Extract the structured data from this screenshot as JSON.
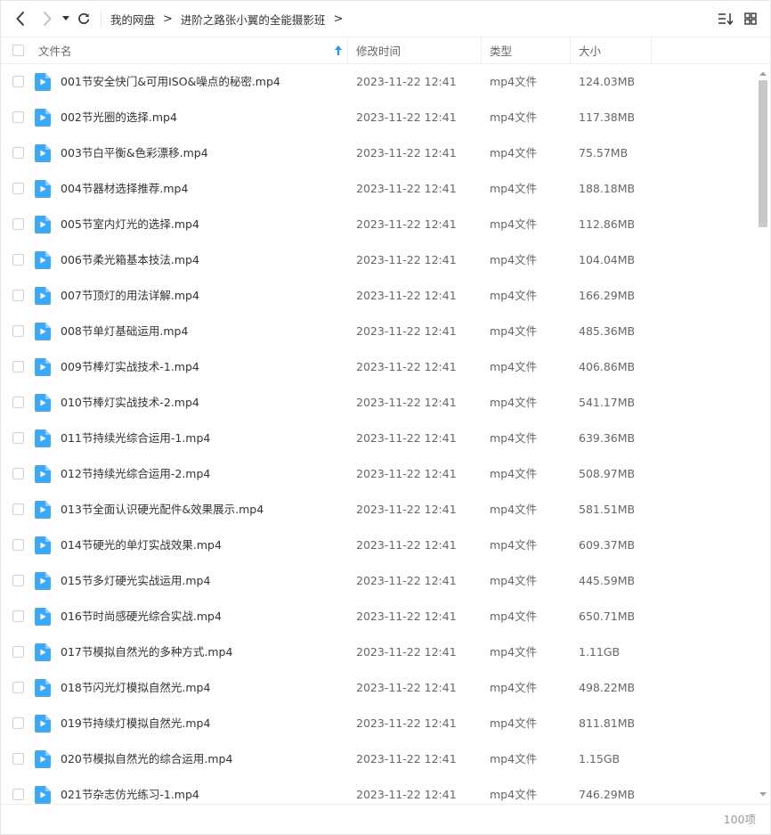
{
  "toolbar": {
    "back_icon": "chevron-left-icon",
    "forward_icon": "chevron-right-icon",
    "history_icon": "caret-down-icon",
    "refresh_icon": "refresh-icon",
    "sort_icon": "sort-list-icon",
    "view_icon": "grid-view-icon"
  },
  "breadcrumb": {
    "items": [
      "我的网盘",
      "进阶之路张小翼的全能摄影班"
    ],
    "separator": ">"
  },
  "columns": {
    "name": "文件名",
    "modified": "修改时间",
    "type": "类型",
    "size": "大小"
  },
  "colors": {
    "file_icon": "#3fa9f5",
    "sort_arrow": "#2196f3",
    "text": "#333333",
    "muted": "#666666"
  },
  "files": [
    {
      "name": "001节安全快门&可用ISO&噪点的秘密.mp4",
      "modified": "2023-11-22 12:41",
      "type": "mp4文件",
      "size": "124.03MB"
    },
    {
      "name": "002节光圈的选择.mp4",
      "modified": "2023-11-22 12:41",
      "type": "mp4文件",
      "size": "117.38MB"
    },
    {
      "name": "003节白平衡&色彩漂移.mp4",
      "modified": "2023-11-22 12:41",
      "type": "mp4文件",
      "size": "75.57MB"
    },
    {
      "name": "004节器材选择推荐.mp4",
      "modified": "2023-11-22 12:41",
      "type": "mp4文件",
      "size": "188.18MB"
    },
    {
      "name": "005节室内灯光的选择.mp4",
      "modified": "2023-11-22 12:41",
      "type": "mp4文件",
      "size": "112.86MB"
    },
    {
      "name": "006节柔光箱基本技法.mp4",
      "modified": "2023-11-22 12:41",
      "type": "mp4文件",
      "size": "104.04MB"
    },
    {
      "name": "007节顶灯的用法详解.mp4",
      "modified": "2023-11-22 12:41",
      "type": "mp4文件",
      "size": "166.29MB"
    },
    {
      "name": "008节单灯基础运用.mp4",
      "modified": "2023-11-22 12:41",
      "type": "mp4文件",
      "size": "485.36MB"
    },
    {
      "name": "009节棒灯实战技术-1.mp4",
      "modified": "2023-11-22 12:41",
      "type": "mp4文件",
      "size": "406.86MB"
    },
    {
      "name": "010节棒灯实战技术-2.mp4",
      "modified": "2023-11-22 12:41",
      "type": "mp4文件",
      "size": "541.17MB"
    },
    {
      "name": "011节持续光综合运用-1.mp4",
      "modified": "2023-11-22 12:41",
      "type": "mp4文件",
      "size": "639.36MB"
    },
    {
      "name": "012节持续光综合运用-2.mp4",
      "modified": "2023-11-22 12:41",
      "type": "mp4文件",
      "size": "508.97MB"
    },
    {
      "name": "013节全面认识硬光配件&效果展示.mp4",
      "modified": "2023-11-22 12:41",
      "type": "mp4文件",
      "size": "581.51MB"
    },
    {
      "name": "014节硬光的单灯实战效果.mp4",
      "modified": "2023-11-22 12:41",
      "type": "mp4文件",
      "size": "609.37MB"
    },
    {
      "name": "015节多灯硬光实战运用.mp4",
      "modified": "2023-11-22 12:41",
      "type": "mp4文件",
      "size": "445.59MB"
    },
    {
      "name": "016节时尚感硬光综合实战.mp4",
      "modified": "2023-11-22 12:41",
      "type": "mp4文件",
      "size": "650.71MB"
    },
    {
      "name": "017节模拟自然光的多种方式.mp4",
      "modified": "2023-11-22 12:41",
      "type": "mp4文件",
      "size": "1.11GB"
    },
    {
      "name": "018节闪光灯模拟自然光.mp4",
      "modified": "2023-11-22 12:41",
      "type": "mp4文件",
      "size": "498.22MB"
    },
    {
      "name": "019节持续灯模拟自然光.mp4",
      "modified": "2023-11-22 12:41",
      "type": "mp4文件",
      "size": "811.81MB"
    },
    {
      "name": "020节模拟自然光的综合运用.mp4",
      "modified": "2023-11-22 12:41",
      "type": "mp4文件",
      "size": "1.15GB"
    },
    {
      "name": "021节杂志仿光练习-1.mp4",
      "modified": "2023-11-22 12:41",
      "type": "mp4文件",
      "size": "746.29MB"
    }
  ],
  "footer": {
    "item_count": "100项"
  }
}
